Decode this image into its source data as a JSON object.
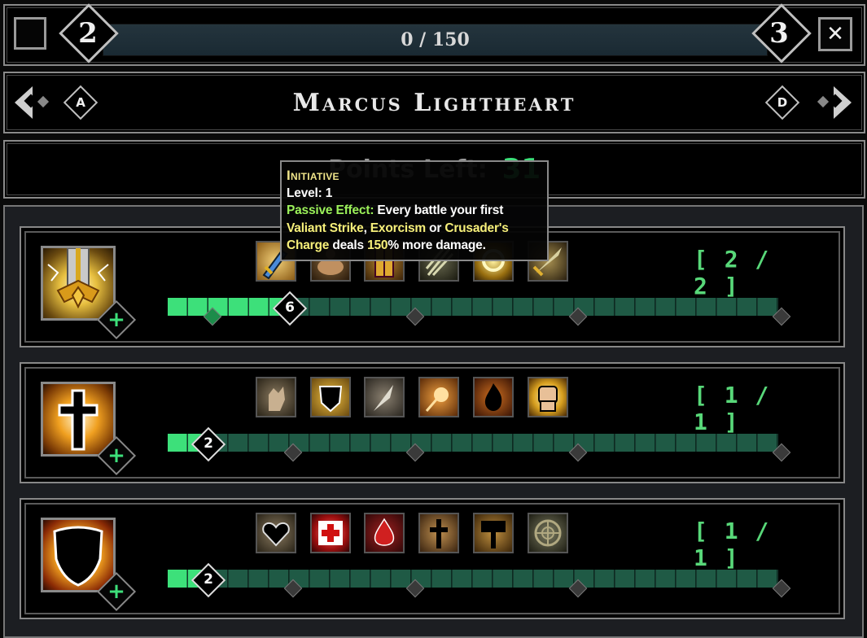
{
  "top_bar": {
    "level_left": "2",
    "level_right": "3",
    "xp_text": "0 / 150",
    "close_label": "✕",
    "xp_progress": 0.0
  },
  "character": {
    "name": "Marcus Lightheart",
    "prev_key": "A",
    "next_key": "D"
  },
  "points": {
    "label": "Points Left:",
    "value": "31"
  },
  "tooltip": {
    "title": "Initiative",
    "level": "Level: 1",
    "effect_label": "Passive Effect:",
    "desc_1": "Every battle your first",
    "skill_1a": "Valiant",
    "skill_1b": "Strike",
    "comma": ",",
    "skill_2": "Exorcism",
    "or": "or",
    "skill_3": "Crusader's Charge",
    "deals": "deals",
    "percent": "150",
    "desc_2": "% more damage."
  },
  "trees": [
    {
      "name": "sword-tree",
      "rank": "[ 2 / 2 ]",
      "level": "6",
      "filled_segments": 6,
      "skills": [
        "sword-skill-icon",
        "strength-skill-icon",
        "armor-skill-icon",
        "claw-skill-icon",
        "halo-skill-icon",
        "blade-skill-icon"
      ]
    },
    {
      "name": "cross-tree",
      "rank": "[ 1 / 1 ]",
      "level": "2",
      "filled_segments": 2,
      "skills": [
        "hand-skill-icon",
        "shield-skill-icon",
        "feather-skill-icon",
        "orb-skill-icon",
        "fire-skill-icon",
        "fist-skill-icon"
      ]
    },
    {
      "name": "shield-tree",
      "rank": "[ 1 / 1 ]",
      "level": "2",
      "filled_segments": 2,
      "skills": [
        "heart-skill-icon",
        "red-cross-skill-icon",
        "blood-drop-skill-icon",
        "cross-skill-icon",
        "hammer-skill-icon",
        "target-skill-icon"
      ]
    }
  ],
  "colors": {
    "accent_green": "#3de07a",
    "rank_green": "#58d879",
    "tooltip_yellow": "#f7f07a",
    "tooltip_green": "#9cf25a"
  }
}
